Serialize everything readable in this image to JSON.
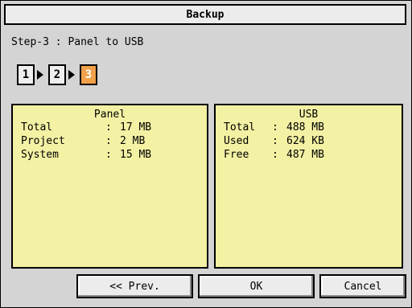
{
  "window": {
    "title": "Backup"
  },
  "step_label": "Step-3 : Panel to USB",
  "steps": [
    {
      "label": "1",
      "active": false
    },
    {
      "label": "2",
      "active": false
    },
    {
      "label": "3",
      "active": true
    }
  ],
  "panel_info": {
    "title": "Panel",
    "rows": [
      {
        "key": "Total",
        "value": "17 MB"
      },
      {
        "key": "Project",
        "value": "2 MB"
      },
      {
        "key": "System",
        "value": "15 MB"
      }
    ]
  },
  "usb_info": {
    "title": "USB",
    "rows": [
      {
        "key": "Total",
        "value": "488 MB"
      },
      {
        "key": "Used",
        "value": "624 KB"
      },
      {
        "key": "Free",
        "value": "487 MB"
      }
    ]
  },
  "buttons": {
    "prev": "<< Prev.",
    "ok": "OK",
    "cancel": "Cancel"
  },
  "colors": {
    "info_bg": "#f3f1a3",
    "active_step": "#f2a04a"
  }
}
